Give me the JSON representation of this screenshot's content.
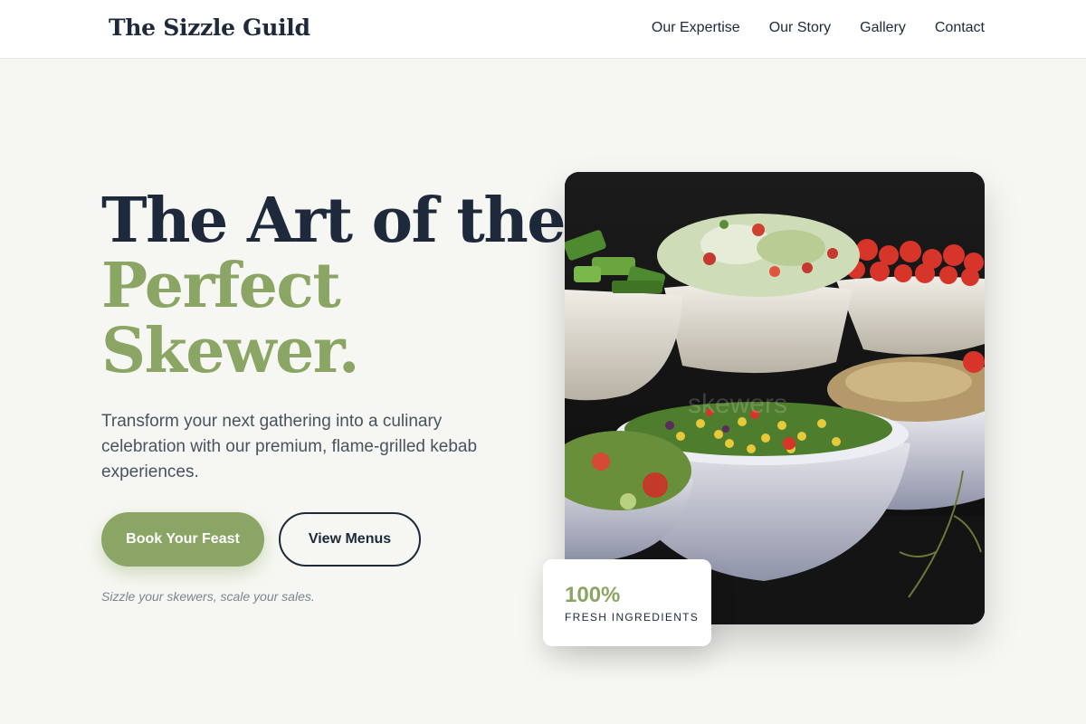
{
  "header": {
    "logo": "The Sizzle Guild",
    "nav": [
      "Our Expertise",
      "Our Story",
      "Gallery",
      "Contact"
    ]
  },
  "hero": {
    "title_line1": "The Art of the",
    "title_line2": "Perfect",
    "title_line3": "Skewer.",
    "subtitle": "Transform your next gathering into a culinary celebration with our premium, flame-grilled kebab experiences.",
    "primary_button": "Book Your Feast",
    "secondary_button": "View Menus",
    "tagline": "Sizzle your skewers, scale your sales."
  },
  "stat": {
    "value": "100%",
    "label": "FRESH INGREDIENTS"
  },
  "image": {
    "watermark": "skewers"
  },
  "colors": {
    "accent": "#8aa564",
    "dark": "#1e293b",
    "background": "#f6f7f2"
  }
}
